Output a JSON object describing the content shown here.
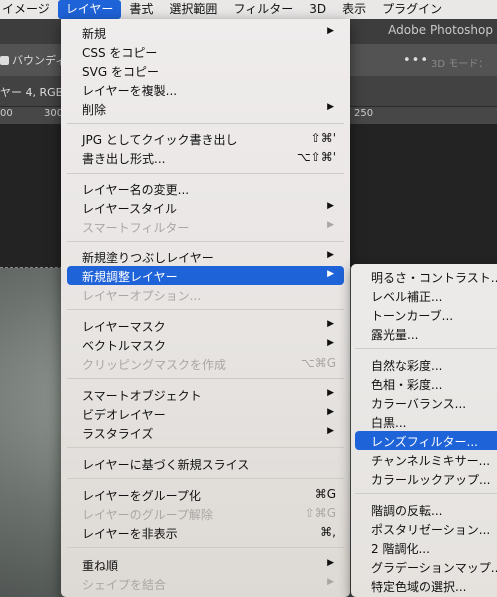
{
  "menubar": {
    "items": [
      "イメージ",
      "レイヤー",
      "書式",
      "選択範囲",
      "フィルター",
      "3D",
      "表示",
      "プラグイン"
    ],
    "active_index": 1
  },
  "photoshop": {
    "app_title": "Adobe Photoshop",
    "bounding_label": "バウンディ",
    "more_dots": "•••",
    "mode_3d": "3D モード：",
    "doc_tab": "ヤー 4, RGB",
    "ruler_ticks": [
      "00",
      "300",
      "250"
    ]
  },
  "layer_menu": {
    "items": [
      {
        "label": "新規",
        "shortcut": "",
        "submenu": true,
        "disabled": false
      },
      {
        "label": "CSS をコピー",
        "shortcut": "",
        "submenu": false,
        "disabled": false
      },
      {
        "label": "SVG をコピー",
        "shortcut": "",
        "submenu": false,
        "disabled": false
      },
      {
        "label": "レイヤーを複製...",
        "shortcut": "",
        "submenu": false,
        "disabled": false
      },
      {
        "label": "削除",
        "shortcut": "",
        "submenu": true,
        "disabled": false
      },
      {
        "label": "JPG としてクイック書き出し",
        "shortcut": "⇧⌘'",
        "submenu": false,
        "disabled": false
      },
      {
        "label": "書き出し形式...",
        "shortcut": "⌥⇧⌘'",
        "submenu": false,
        "disabled": false
      },
      {
        "label": "レイヤー名の変更...",
        "shortcut": "",
        "submenu": false,
        "disabled": false
      },
      {
        "label": "レイヤースタイル",
        "shortcut": "",
        "submenu": true,
        "disabled": false
      },
      {
        "label": "スマートフィルター",
        "shortcut": "",
        "submenu": true,
        "disabled": true
      },
      {
        "label": "新規塗りつぶしレイヤー",
        "shortcut": "",
        "submenu": true,
        "disabled": false
      },
      {
        "label": "新規調整レイヤー",
        "shortcut": "",
        "submenu": true,
        "disabled": false,
        "highlighted": true
      },
      {
        "label": "レイヤーオプション...",
        "shortcut": "",
        "submenu": false,
        "disabled": true
      },
      {
        "label": "レイヤーマスク",
        "shortcut": "",
        "submenu": true,
        "disabled": false
      },
      {
        "label": "ベクトルマスク",
        "shortcut": "",
        "submenu": true,
        "disabled": false
      },
      {
        "label": "クリッピングマスクを作成",
        "shortcut": "⌥⌘G",
        "submenu": false,
        "disabled": true
      },
      {
        "label": "スマートオブジェクト",
        "shortcut": "",
        "submenu": true,
        "disabled": false
      },
      {
        "label": "ビデオレイヤー",
        "shortcut": "",
        "submenu": true,
        "disabled": false
      },
      {
        "label": "ラスタライズ",
        "shortcut": "",
        "submenu": true,
        "disabled": false
      },
      {
        "label": "レイヤーに基づく新規スライス",
        "shortcut": "",
        "submenu": false,
        "disabled": false
      },
      {
        "label": "レイヤーをグループ化",
        "shortcut": "⌘G",
        "submenu": false,
        "disabled": false
      },
      {
        "label": "レイヤーのグループ解除",
        "shortcut": "⇧⌘G",
        "submenu": false,
        "disabled": true
      },
      {
        "label": "レイヤーを非表示",
        "shortcut": "⌘,",
        "submenu": false,
        "disabled": false
      },
      {
        "label": "重ね順",
        "shortcut": "",
        "submenu": true,
        "disabled": false
      },
      {
        "label": "シェイプを結合",
        "shortcut": "",
        "submenu": true,
        "disabled": true
      }
    ]
  },
  "adjustment_submenu": {
    "items": [
      "明るさ・コントラスト...",
      "レベル補正...",
      "トーンカーブ...",
      "露光量...",
      "自然な彩度...",
      "色相・彩度...",
      "カラーバランス...",
      "白黒...",
      "レンズフィルター...",
      "チャンネルミキサー...",
      "カラールックアップ...",
      "階調の反転...",
      "ポスタリゼーション...",
      "2 階調化...",
      "グラデーションマップ...",
      "特定色域の選択..."
    ],
    "highlighted_index": 8
  },
  "colors": {
    "highlight": "#1f63d9",
    "menu_bg": "#ebe8e6",
    "disabled_text": "#a9a7a4"
  }
}
